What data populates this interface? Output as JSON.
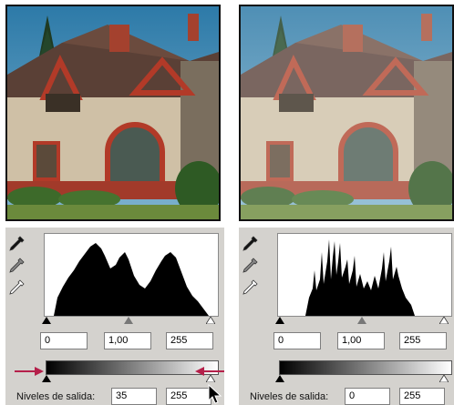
{
  "left_panel": {
    "input_levels": {
      "black": "0",
      "gamma": "1,00",
      "white": "255"
    },
    "output_levels": {
      "label": "Niveles de salida:",
      "black": "35",
      "white": "255"
    }
  },
  "right_panel": {
    "input_levels": {
      "black": "0",
      "gamma": "1,00",
      "white": "255"
    },
    "output_levels": {
      "label": "Niveles de salida:",
      "black": "0",
      "white": "255"
    }
  },
  "icons": [
    "eyedropper-black-icon",
    "eyedropper-gray-icon",
    "eyedropper-white-icon",
    "pointer-arrow-icon",
    "cursor-arrow-icon"
  ],
  "colors": {
    "arrow": "#b5204a",
    "panel": "#d4d2ce",
    "sky": "#3c7fa8"
  }
}
